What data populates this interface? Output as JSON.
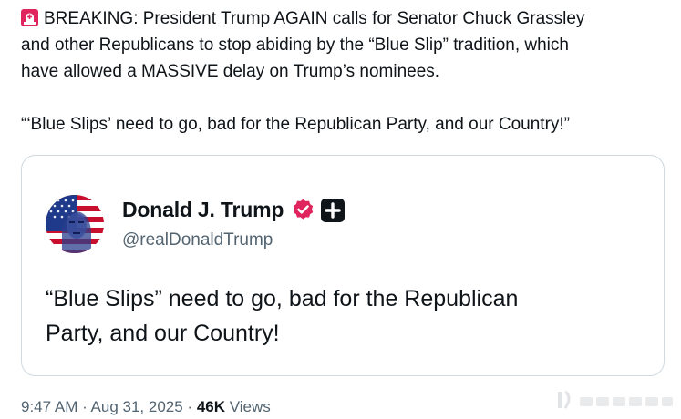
{
  "tweet": {
    "line1": "BREAKING: President Trump AGAIN calls for Senator Chuck Grassley",
    "line2": "and other Republicans to stop abiding by the “Blue Slip” tradition, which",
    "line3": "have allowed a MASSIVE delay on Trump’s nominees.",
    "quote_line": "“‘Blue Slips’ need to go, bad for the Republican Party, and our Country!”",
    "emoji": "police-siren-emoji"
  },
  "quoted_post": {
    "display_name": "Donald J. Trump",
    "handle": "@realDonaldTrump",
    "text_line1": "“Blue Slips” need to go, bad for the Republican",
    "text_line2": "Party, and our Country!",
    "avatar": "flag-portrait-avatar",
    "badges": [
      "verified-badge-icon",
      "plus-square-icon"
    ]
  },
  "meta": {
    "time": "9:47 AM",
    "sep1": " · ",
    "date": "Aug 31, 2025",
    "sep2": " · ",
    "views_count": "46K",
    "views_label": " Views"
  },
  "colors": {
    "text": "#0f1419",
    "muted": "#536471",
    "border": "#cfd9de",
    "verified": "#e0245e",
    "siren": "#e0245e"
  }
}
